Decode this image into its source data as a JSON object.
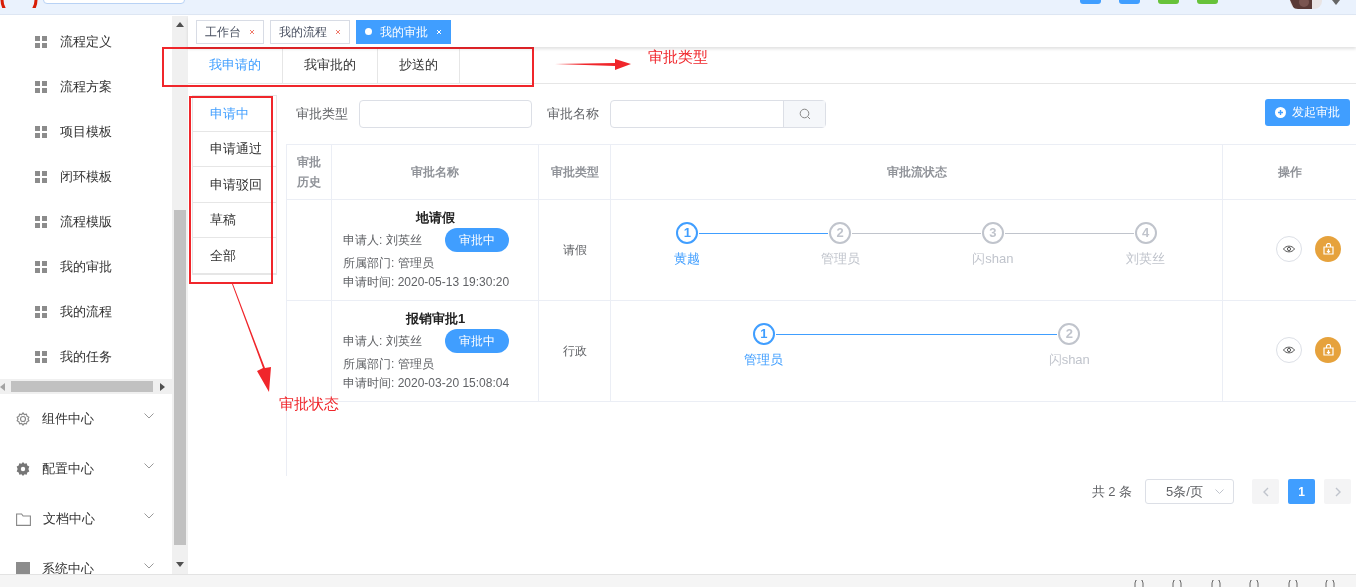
{
  "header": {
    "buttons": [
      {
        "color": "#409eff"
      },
      {
        "color": "#409eff"
      },
      {
        "color": "#67c23a"
      },
      {
        "color": "#67c23a"
      }
    ]
  },
  "sidebar": {
    "items": [
      {
        "label": "流程定义"
      },
      {
        "label": "流程方案"
      },
      {
        "label": "项目模板"
      },
      {
        "label": "闭环模板"
      },
      {
        "label": "流程模版"
      },
      {
        "label": "我的审批"
      },
      {
        "label": "我的流程"
      },
      {
        "label": "我的任务"
      }
    ],
    "groups": [
      {
        "label": "组件中心",
        "kind": "gear"
      },
      {
        "label": "配置中心",
        "kind": "cog"
      },
      {
        "label": "文档中心",
        "kind": "folder"
      },
      {
        "label": "系统中心",
        "kind": "square"
      }
    ]
  },
  "tabs": [
    {
      "label": "工作台",
      "selected": false
    },
    {
      "label": "我的流程",
      "selected": false
    },
    {
      "label": "我的审批",
      "selected": true
    }
  ],
  "type_tabs": [
    {
      "label": "我申请的",
      "selected": true
    },
    {
      "label": "我审批的",
      "selected": false
    },
    {
      "label": "抄送的",
      "selected": false
    }
  ],
  "status_menu": [
    {
      "label": "申请中",
      "selected": true
    },
    {
      "label": "申请通过",
      "selected": false
    },
    {
      "label": "申请驳回",
      "selected": false
    },
    {
      "label": "草稿",
      "selected": false
    },
    {
      "label": "全部",
      "selected": false
    }
  ],
  "filters": [
    {
      "label": "审批类型",
      "kind": "text"
    },
    {
      "label": "审批名称",
      "kind": "search"
    }
  ],
  "new_button": "发起审批",
  "table": {
    "columns": [
      "审批历史",
      "审批名称",
      "审批类型",
      "审批流状态",
      "操作"
    ],
    "rows": [
      {
        "title": "地请假",
        "applicant": "申请人: 刘英丝",
        "badge": "审批中",
        "department": "所属部门: 管理员",
        "time": "申请时间: 2020-05-13 19:30:20",
        "type": "请假",
        "steps": [
          {
            "number": "1",
            "name": "黄越",
            "active": true
          },
          {
            "number": "2",
            "name": "管理员",
            "active": false
          },
          {
            "number": "3",
            "name": "闪shan",
            "active": false
          },
          {
            "number": "4",
            "name": "刘英丝",
            "active": false
          }
        ]
      },
      {
        "title": "报销审批1",
        "applicant": "申请人: 刘英丝",
        "badge": "审批中",
        "department": "所属部门: 管理员",
        "time": "申请时间: 2020-03-20 15:08:04",
        "type": "行政",
        "steps": [
          {
            "number": "1",
            "name": "管理员",
            "active": true
          },
          {
            "number": "2",
            "name": "闪shan",
            "active": false
          }
        ]
      }
    ]
  },
  "pagination": {
    "total": "共 2 条",
    "page_size": "5条/页",
    "pages": [
      {
        "label": "1",
        "selected": true
      }
    ]
  },
  "annotations": [
    {
      "label": "审批类型"
    },
    {
      "label": "审批状态"
    }
  ]
}
